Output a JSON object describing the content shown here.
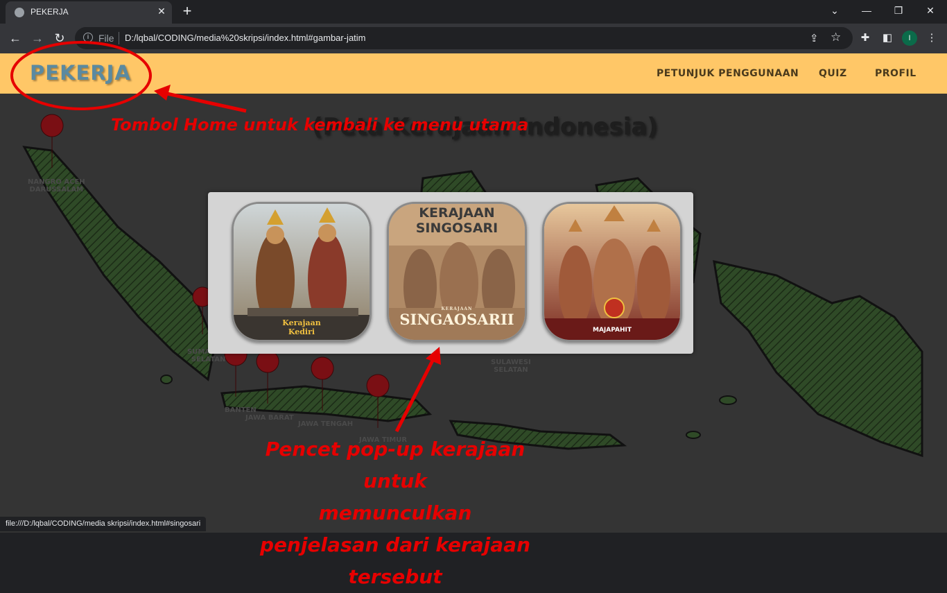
{
  "browser": {
    "tab_title": "PEKERJA",
    "tab_close": "✕",
    "new_tab": "+",
    "omnibox_label": "File",
    "url": "D:/lqbal/CODING/media%20skripsi/index.html#gambar-jatim",
    "profile_initial": "I",
    "status_url": "file:///D:/lqbal/CODING/media skripsi/index.html#singosari"
  },
  "navbar": {
    "brand": "PEKERJA",
    "links": [
      "PETUNJUK PENGGUNAAN",
      "QUIZ",
      "PROFIL"
    ]
  },
  "page": {
    "title": "(Peta Kerajaan Indonesia)",
    "provinces": [
      "NANGRO ACEH",
      "DARUSSALAM",
      "SUMATERA",
      "SELATAN",
      "BANTEN",
      "JAWA BARAT",
      "JAWA TENGAH",
      "JAWA TIMUR",
      "SULAWESI",
      "SELATAN"
    ]
  },
  "popup": {
    "cards": [
      {
        "name": "Kerajaan Kediri",
        "label_line1": "Kerajaan",
        "label_line2": "Kediri"
      },
      {
        "name": "Kerajaan Singosari",
        "header_line1": "KERAJAAN",
        "header_line2": "SINGOSARI",
        "small": "KERAJAAN",
        "label": "SINGAOSARII"
      },
      {
        "name": "Majapahit",
        "label": "MAJAPAHIT"
      }
    ]
  },
  "annotations": {
    "home_note": "Tombol Home untuk kembali ke menu utama",
    "popup_note_line1": "Pencet pop-up kerajaan untuk",
    "popup_note_line2": "memunculkan",
    "popup_note_line3": "penjelasan dari kerajaan tersebut",
    "color": "#e60000"
  },
  "colors": {
    "navbar": "#ffc767",
    "brand": "#5b8aa0",
    "map_land": "#2f4a27",
    "overlay": "#343434",
    "marker": "#7a0f14"
  }
}
